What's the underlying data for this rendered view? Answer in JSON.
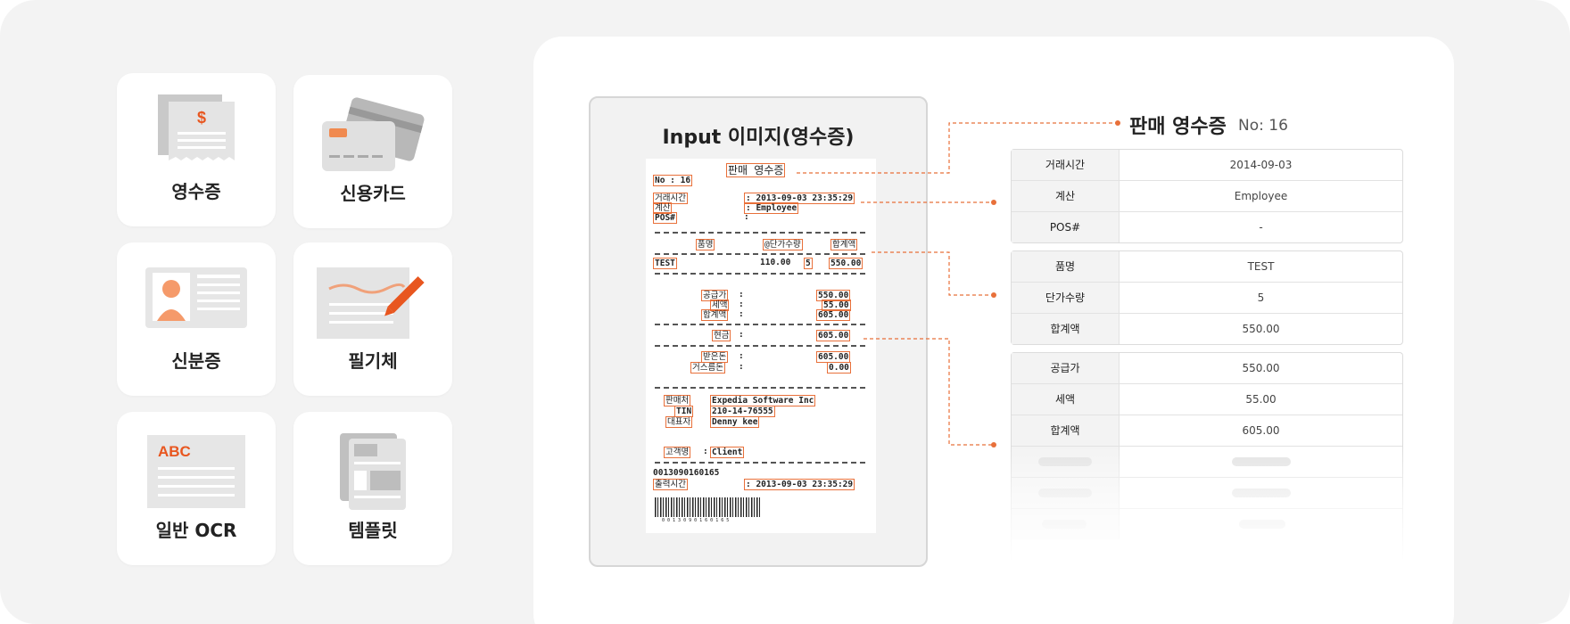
{
  "tiles": [
    {
      "label": "영수증",
      "icon": "receipt-icon"
    },
    {
      "label": "신용카드",
      "icon": "credit-card-icon"
    },
    {
      "label": "신분증",
      "icon": "id-card-icon"
    },
    {
      "label": "필기체",
      "icon": "handwriting-icon"
    },
    {
      "label": "일반 OCR",
      "icon": "document-abc-icon",
      "icon_text": "ABC"
    },
    {
      "label": "템플릿",
      "icon": "template-icon"
    }
  ],
  "receipt_tile_symbol": "$",
  "input": {
    "title": "Input 이미지(영수증)",
    "receipt": {
      "title": "판매 영수증",
      "no": "No : 16",
      "time_label": "거래시간",
      "time_value": ": 2013-09-03 23:35:29",
      "calc_label": "계산",
      "calc_value": ": Employee",
      "pos_label": "POS#",
      "pos_value": ":",
      "col_item": "품명",
      "col_unit": "@단가수량",
      "col_total": "합계액",
      "item_name": "TEST",
      "item_price": "110.00",
      "item_qty": "5",
      "item_total": "550.00",
      "supply_label": "공급가",
      "supply_value": "550.00",
      "tax_label": "세액",
      "tax_value": "55.00",
      "sum_label": "합계액",
      "sum_value": "605.00",
      "cash_label": "현금",
      "cash_value": "605.00",
      "received_label": "받은돈",
      "received_value": "605.00",
      "change_label": "거스름돈",
      "change_value": "0.00",
      "seller_label": "판매처",
      "seller_value": "Expedia Software Inc",
      "tin_label": "TIN",
      "tin_value": "210-14-76555",
      "ceo_label": "대표자",
      "ceo_value": "Denny kee",
      "customer_label": "고객명",
      "customer_value": "Client",
      "barcode_number": "0013090160165",
      "print_label": "출력시간",
      "print_value": ": 2013-09-03 23:35:29",
      "barcode_digits": "0 0 1 3 0 9 0 1 6 0 1 6 5"
    }
  },
  "result": {
    "title": "판매 영수증",
    "no": "No: 16",
    "groups": [
      [
        {
          "key": "거래시간",
          "value": "2014-09-03"
        },
        {
          "key": "계산",
          "value": "Employee"
        },
        {
          "key": "POS#",
          "value": "-"
        }
      ],
      [
        {
          "key": "품명",
          "value": "TEST"
        },
        {
          "key": "단가수량",
          "value": "5"
        },
        {
          "key": "합계액",
          "value": "550.00"
        }
      ],
      [
        {
          "key": "공급가",
          "value": "550.00"
        },
        {
          "key": "세액",
          "value": "55.00"
        },
        {
          "key": "합계액",
          "value": "605.00"
        }
      ]
    ]
  },
  "colors": {
    "accent": "#e8703a",
    "background": "#f3f3f3",
    "panel": "#ffffff"
  }
}
